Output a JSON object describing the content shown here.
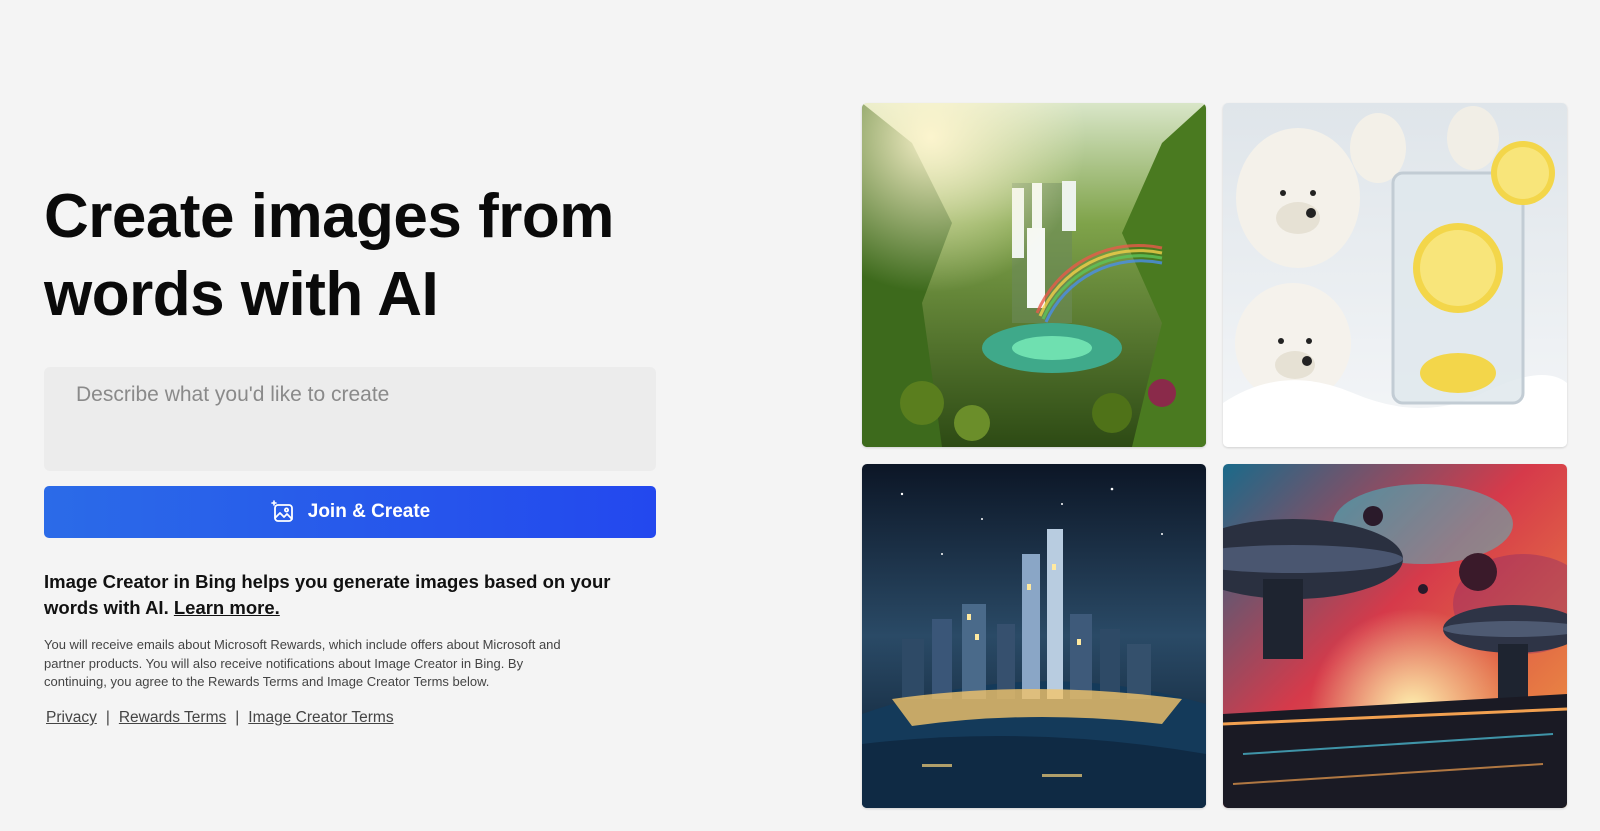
{
  "hero": {
    "headline": "Create images from words with AI"
  },
  "prompt": {
    "placeholder": "Describe what you'd like to create",
    "value": ""
  },
  "cta": {
    "label": "Join & Create",
    "icon": "image-sparkle-icon"
  },
  "description": {
    "text": "Image Creator in Bing helps you generate images based on your words with AI.",
    "learn_more": "Learn more."
  },
  "fine_print": "You will receive emails about Microsoft Rewards, which include offers about Microsoft and partner products. You will also receive notifications about Image Creator in Bing. By continuing, you agree to the Rewards Terms and Image Creator Terms below.",
  "footer": {
    "privacy": "Privacy",
    "separator": "|",
    "rewards_terms": "Rewards Terms",
    "image_creator_terms": "Image Creator Terms"
  },
  "gallery": [
    {
      "subject": "jungle-waterfall-rainbow"
    },
    {
      "subject": "polar-bears-lemonade"
    },
    {
      "subject": "night-city-skyline"
    },
    {
      "subject": "sci-fi-nebula-space-station"
    }
  ],
  "colors": {
    "background": "#f4f4f4",
    "button_start": "#2b6be8",
    "button_end": "#2348ee",
    "text": "#111111"
  }
}
